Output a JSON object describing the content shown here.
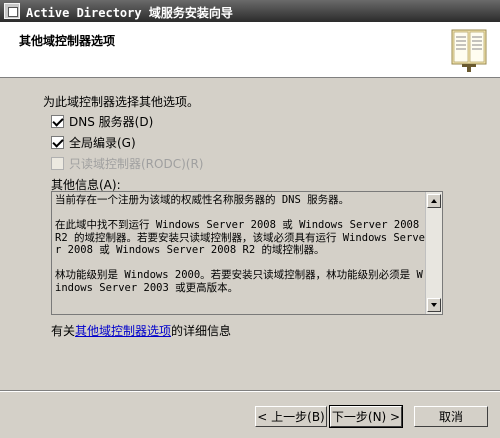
{
  "window": {
    "title": "Active Directory 域服务安装向导"
  },
  "header": {
    "title": "其他域控制器选项",
    "icon": "book-icon"
  },
  "main": {
    "intro": "为此域控制器选择其他选项。",
    "options": [
      {
        "label": "DNS 服务器(D)",
        "checked": true,
        "enabled": true
      },
      {
        "label": "全局编录(G)",
        "checked": true,
        "enabled": true
      },
      {
        "label": "只读域控制器(RODC)(R)",
        "checked": false,
        "enabled": false
      }
    ],
    "info_label": "其他信息(A):",
    "info_text": "当前存在一个注册为该域的权威性名称服务器的 DNS 服务器。\n\n在此域中找不到运行 Windows Server 2008 或 Windows Server 2008 R2 的域控制器。若要安装只读域控制器，该域必须具有运行 Windows Server 2008 或 Windows Server 2008 R2 的域控制器。\n\n林功能级别是 Windows 2000。若要安装只读域控制器，林功能级别必须是 Windows Server 2003 或更高版本。",
    "more_info_prefix": "有关",
    "more_info_link": "其他域控制器选项",
    "more_info_suffix": "的详细信息"
  },
  "buttons": {
    "back": "< 上一步(B)",
    "next": "下一步(N) >",
    "cancel": "取消"
  }
}
